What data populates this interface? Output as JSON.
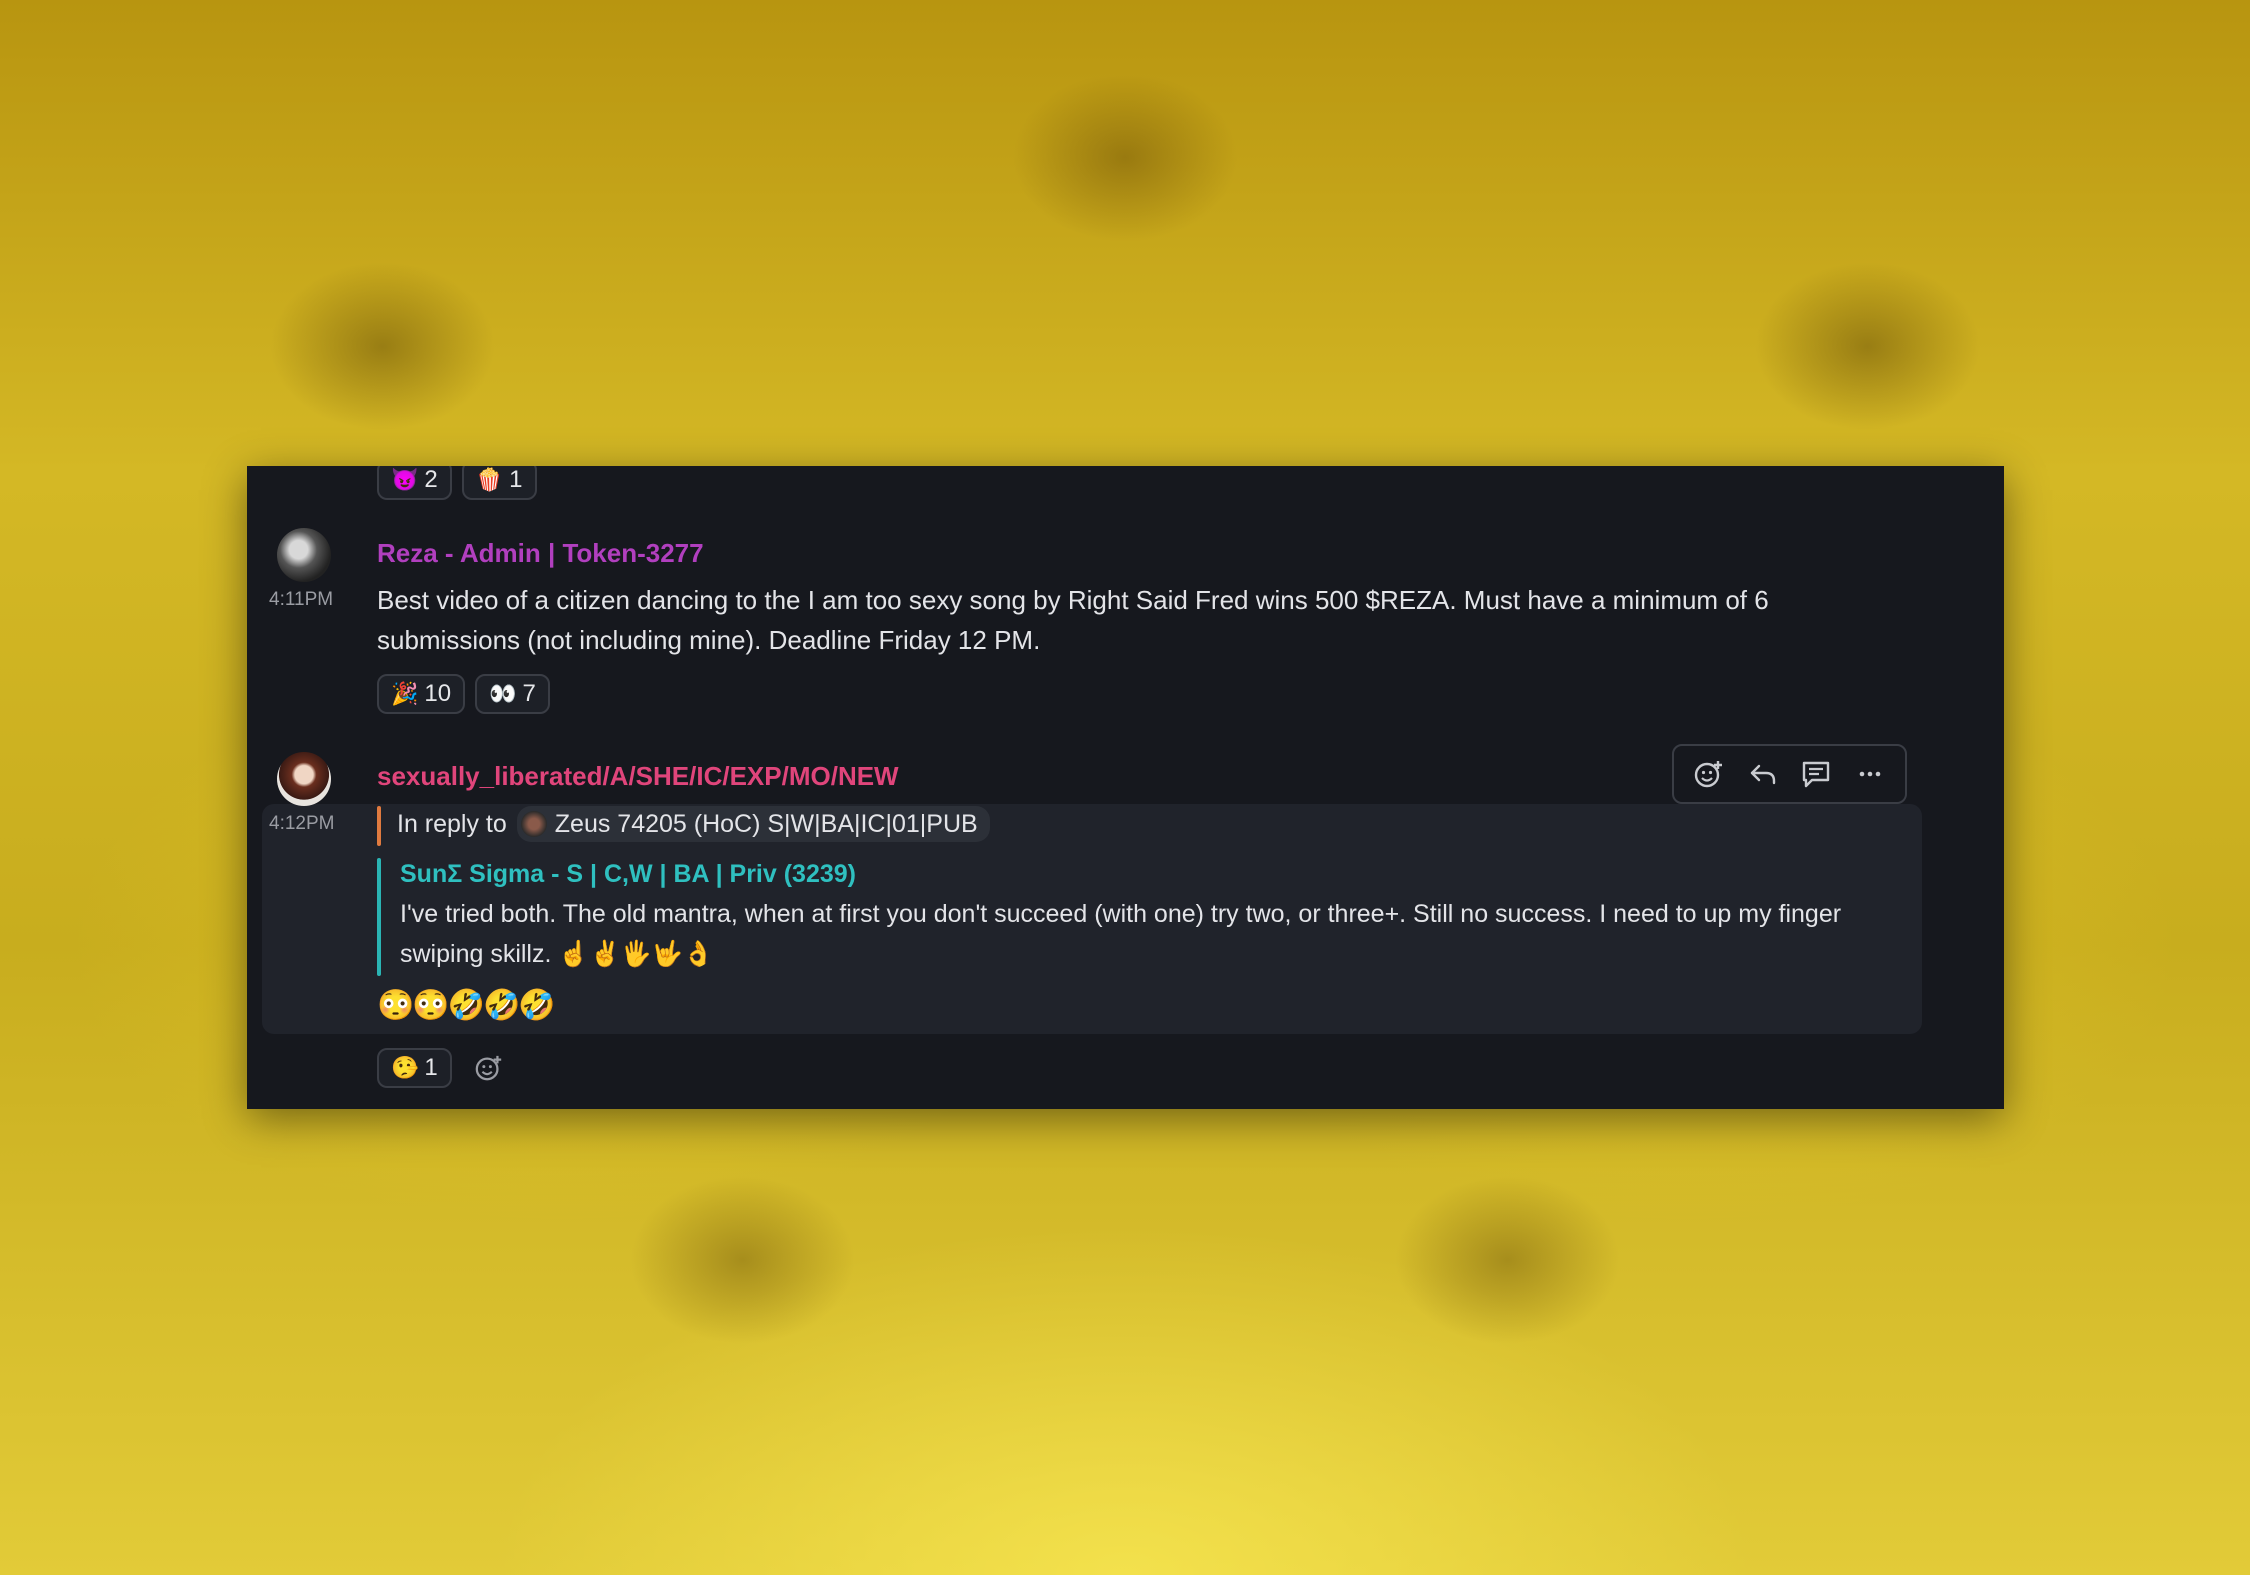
{
  "top_reactions": [
    {
      "emoji": "😈",
      "count": "2"
    },
    {
      "emoji": "🍿",
      "count": "1"
    }
  ],
  "message1": {
    "username": "Reza - Admin | Token-3277",
    "username_color": "#b13fbf",
    "time": "4:11PM",
    "text": "Best video of a citizen dancing to the I am too sexy song by Right Said Fred wins 500 $REZA. Must have a minimum of 6 submissions (not including mine). Deadline Friday 12 PM.",
    "reactions": [
      {
        "emoji": "🎉",
        "count": "10"
      },
      {
        "emoji": "👀",
        "count": "7"
      }
    ]
  },
  "message2": {
    "username": "sexually_liberated/A/SHE/IC/EXP/MO/NEW",
    "username_color": "#e0457b",
    "time": "4:12PM",
    "reply_label": "In reply to",
    "reply_target": "Zeus 74205 (HoC) S|W|BA|IC|01|PUB",
    "quoted_user": "SunΣ Sigma - S | C,W | BA | Priv (3239)",
    "quoted_user_color": "#2fc0c0",
    "quoted_text": "I've tried both. The old mantra, when at first you don't succeed (with one) try two, or three+. Still no success. I need to up my finger swiping skillz. ☝️✌️🖐️🤟👌",
    "body_emojis": "😳😳🤣🤣🤣",
    "reactions": [
      {
        "emoji": "🤥",
        "count": "1"
      }
    ]
  },
  "hover_actions": [
    "add-reaction-icon",
    "reply-icon",
    "thread-icon",
    "more-icon"
  ]
}
